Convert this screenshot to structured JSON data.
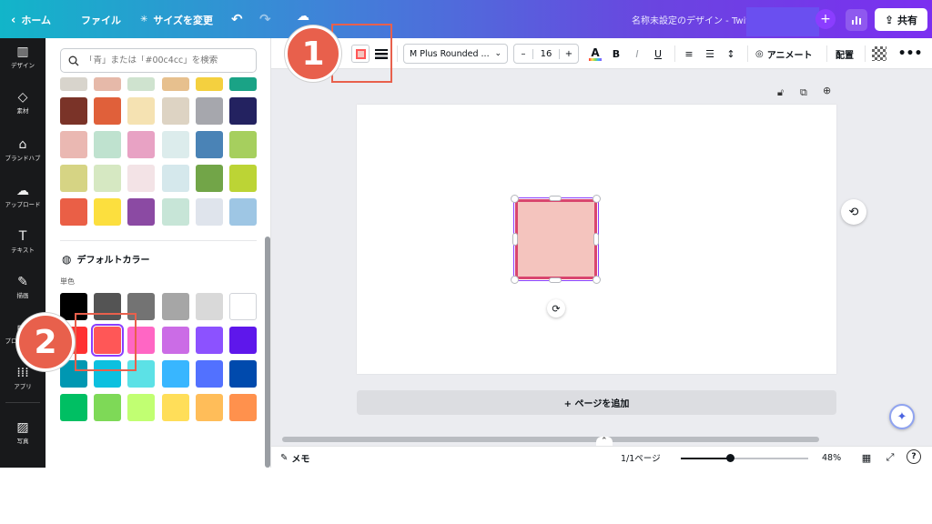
{
  "topbar": {
    "home_label": "ホーム",
    "file_label": "ファイル",
    "resize_label": "サイズを変更",
    "doc_title": "名称未設定のデザイン - Twitt",
    "share_label": "共有"
  },
  "leftnav": {
    "items": [
      {
        "label": "デザイン",
        "icon": "layout-icon"
      },
      {
        "label": "素材",
        "icon": "shapes-icon"
      },
      {
        "label": "ブランドハブ",
        "icon": "brand-icon"
      },
      {
        "label": "アップロード",
        "icon": "cloud-upload-icon"
      },
      {
        "label": "テキスト",
        "icon": "text-icon"
      },
      {
        "label": "描画",
        "icon": "pen-icon"
      },
      {
        "label": "プロジェクト",
        "icon": "folder-icon"
      },
      {
        "label": "アプリ",
        "icon": "apps-grid-icon"
      },
      {
        "label": "写真",
        "icon": "photo-icon"
      }
    ]
  },
  "panel": {
    "search_placeholder": "「青」または「#00c4cc」を検索",
    "default_colors_title": "デフォルトカラー",
    "solid_label": "単色",
    "palette_rows": [
      [
        "#d8d4cc",
        "#e6b9a9",
        "#cfe3cf",
        "#e7c08e",
        "#f4d03f",
        "#1aa386"
      ],
      [
        "#7a3328",
        "#e0603a",
        "#f5e2b2",
        "#ddd3c3",
        "#a6a7ad",
        "#232260"
      ],
      [
        "#eab8b2",
        "#bfe2cf",
        "#e8a2c4",
        "#dcecec",
        "#4a83b6",
        "#a6cf5e"
      ],
      [
        "#d6d484",
        "#d6e8c2",
        "#f3e3e6",
        "#d5e8ec",
        "#72a548",
        "#bcd435"
      ],
      [
        "#ea5f46",
        "#fcdf3e",
        "#8b4aa3",
        "#c7e5d7",
        "#dfe4ec",
        "#9ec6e4"
      ]
    ],
    "default_rows": [
      [
        "#000000",
        "#545454",
        "#737373",
        "#a6a6a6",
        "#d9d9d9",
        "#ffffff"
      ],
      [
        "#ff3131",
        "#ff5757",
        "#ff66c4",
        "#cb6ce6",
        "#8c52ff",
        "#5e17eb"
      ],
      [
        "#0097b2",
        "#0cc0df",
        "#5ce1e6",
        "#38b6ff",
        "#5271ff",
        "#004aad"
      ],
      [
        "#00bf63",
        "#7ed957",
        "#c1ff72",
        "#ffde59",
        "#ffbd59",
        "#ff914d"
      ]
    ]
  },
  "toolbar": {
    "font_name": "M Plus Rounded ...",
    "font_size": "16",
    "animate_label": "アニメート",
    "position_label": "配置"
  },
  "canvas": {
    "add_page_label": "+ ページを追加",
    "shape_fill": "#f4c4be",
    "shape_border": "#d9466f"
  },
  "bottombar": {
    "notes_label": "メモ",
    "page_indicator": "1/1ページ",
    "zoom": "48%",
    "zoom_level": 0.48
  },
  "callouts": {
    "one": "1",
    "two": "2"
  }
}
